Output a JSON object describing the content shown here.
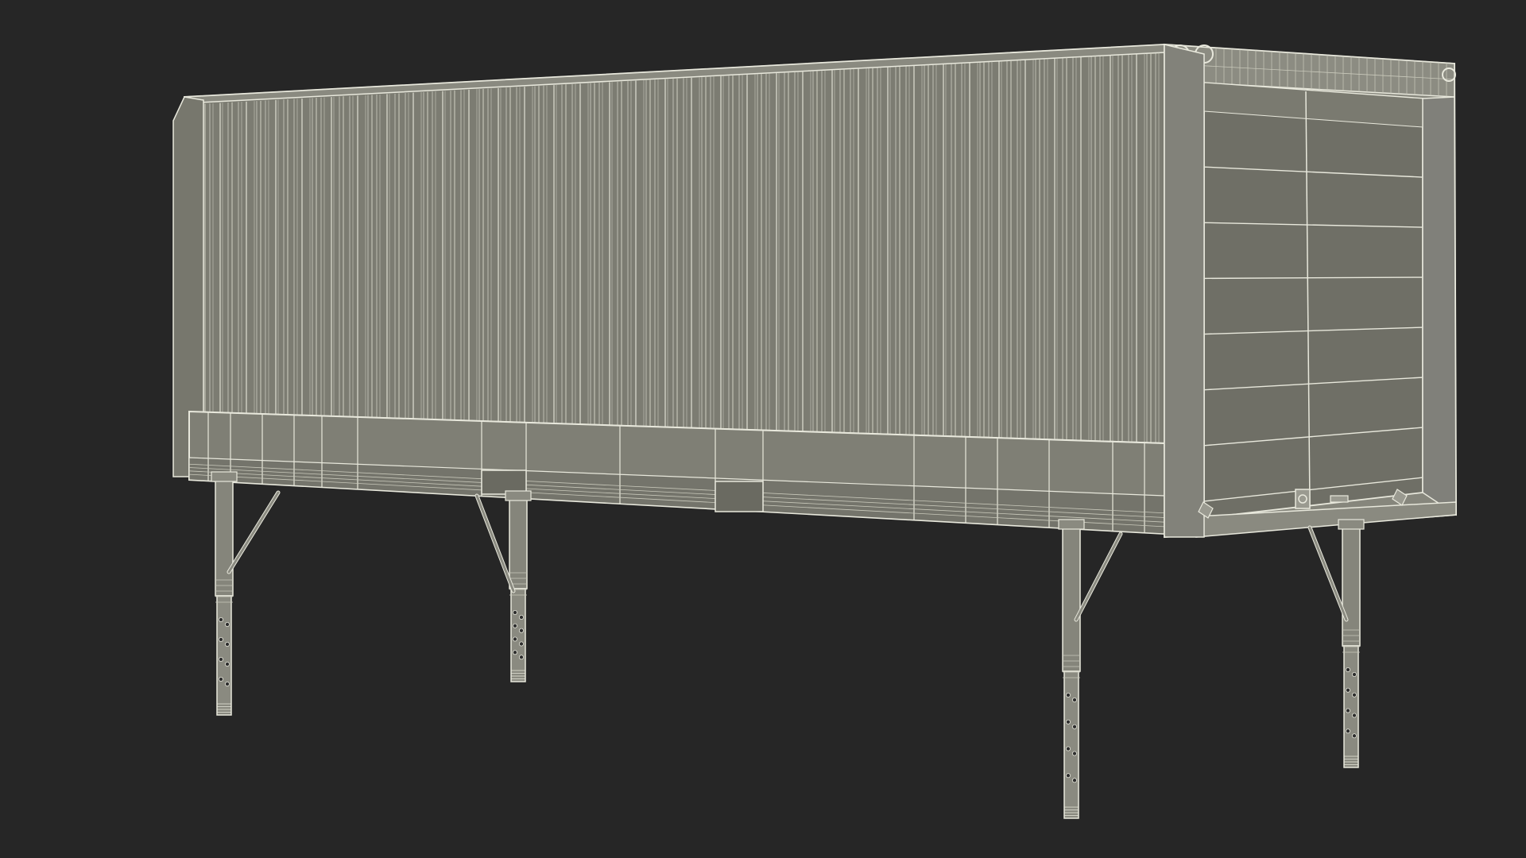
{
  "scene": {
    "subject": "swap-body-container-wireframe",
    "render_style": "wireframe-on-shaded",
    "colors": {
      "background": "#262626",
      "body_fill": "#7a7a70",
      "body_fill_dark": "#6f6f66",
      "side_fill": "#818176",
      "wire": "#e8e8dc",
      "wire_faint": "#c9c9bb",
      "leg_fill": "#8a8a80"
    },
    "legs": {
      "count": 4,
      "foot_hole_rows": 4
    },
    "rear_panel_rows": 7
  }
}
